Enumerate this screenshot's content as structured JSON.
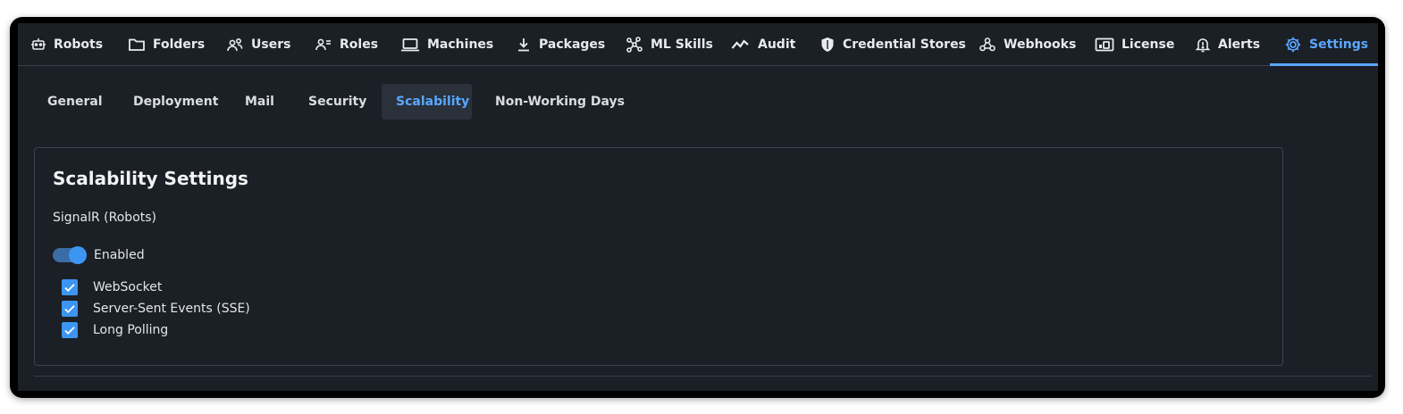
{
  "nav": {
    "tabs": [
      {
        "label": "Robots",
        "icon": "robot-icon"
      },
      {
        "label": "Folders",
        "icon": "folder-icon"
      },
      {
        "label": "Users",
        "icon": "users-icon"
      },
      {
        "label": "Roles",
        "icon": "roles-icon"
      },
      {
        "label": "Machines",
        "icon": "laptop-icon"
      },
      {
        "label": "Packages",
        "icon": "download-icon"
      },
      {
        "label": "ML Skills",
        "icon": "ml-skills-icon"
      },
      {
        "label": "Audit",
        "icon": "audit-icon"
      },
      {
        "label": "Credential Stores",
        "icon": "shield-icon"
      },
      {
        "label": "Webhooks",
        "icon": "webhook-icon"
      },
      {
        "label": "License",
        "icon": "license-icon"
      },
      {
        "label": "Alerts",
        "icon": "bell-icon"
      },
      {
        "label": "Settings",
        "icon": "gear-icon"
      }
    ],
    "active": "Settings"
  },
  "subnav": {
    "tabs": [
      "General",
      "Deployment",
      "Mail",
      "Security",
      "Scalability",
      "Non-Working Days"
    ],
    "active": "Scalability"
  },
  "panel": {
    "title": "Scalability Settings",
    "section_label": "SignalR (Robots)",
    "toggle": {
      "label": "Enabled",
      "on": true
    },
    "checkboxes": [
      {
        "label": "WebSocket",
        "checked": true
      },
      {
        "label": "Server-Sent Events (SSE)",
        "checked": true
      },
      {
        "label": "Long Polling",
        "checked": true
      }
    ]
  },
  "colors": {
    "background": "#1b1f26",
    "accent": "#5aa7ff",
    "active_subtab_bg": "#2a313b",
    "checkbox": "#3d95f2"
  }
}
